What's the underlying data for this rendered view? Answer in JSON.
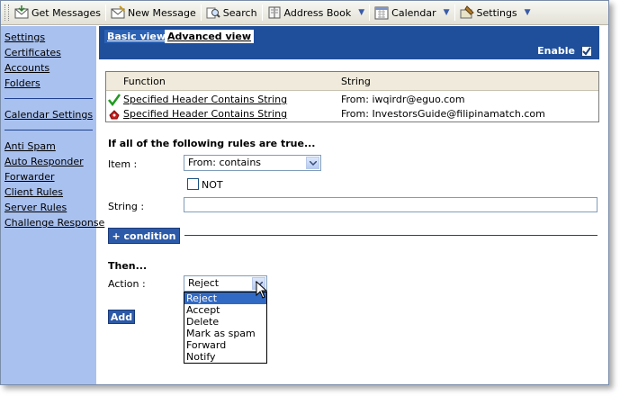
{
  "toolbar": {
    "items": [
      {
        "label": "Get Messages",
        "icon": "get-messages-icon"
      },
      {
        "label": "New Message",
        "icon": "new-message-icon"
      },
      {
        "label": "Search",
        "icon": "search-icon"
      },
      {
        "label": "Address Book",
        "icon": "address-book-icon",
        "dropdown": true
      },
      {
        "label": "Calendar",
        "icon": "calendar-icon",
        "dropdown": true
      },
      {
        "label": "Settings",
        "icon": "settings-icon",
        "dropdown": true
      }
    ],
    "dropdown_glyph": "▼"
  },
  "sidebar": {
    "group1": [
      "Settings",
      "Certificates",
      "Accounts",
      "Folders"
    ],
    "group2": [
      "Calendar Settings"
    ],
    "group3": [
      "Anti Spam",
      "Auto Responder",
      "Forwarder",
      "Client Rules",
      "Server Rules",
      "Challenge Response"
    ]
  },
  "tabs": {
    "basic": "Basic view",
    "advanced": "Advanced view"
  },
  "enable": {
    "label": "Enable",
    "checked": true
  },
  "rules_table": {
    "headers": {
      "function": "Function",
      "string": "String"
    },
    "rows": [
      {
        "function": "Specified Header Contains String",
        "string": "From: iwqirdr@eguo.com",
        "status_icon": "check-icon"
      },
      {
        "function": "Specified Header Contains String",
        "string": "From: InvestorsGuide@filipinamatch.com",
        "status_icon": "reject-icon"
      }
    ]
  },
  "form": {
    "title": "If all of the following rules are true...",
    "item_label": "Item :",
    "item_value": "From: contains",
    "not_label": "NOT",
    "not_checked": false,
    "string_label": "String :",
    "string_value": "",
    "condition_button": "+ condition",
    "then_title": "Then...",
    "action_label": "Action :",
    "action_value": "Reject",
    "action_options": [
      "Reject",
      "Accept",
      "Delete",
      "Mark as spam",
      "Forward",
      "Notify"
    ],
    "action_highlighted": "Reject",
    "add_button": "Add"
  },
  "colors": {
    "sidebar_bg": "#a9c1ef",
    "header_blue": "#1f4e9a",
    "button_blue": "#2c5aa8",
    "highlight": "#316ac5"
  }
}
